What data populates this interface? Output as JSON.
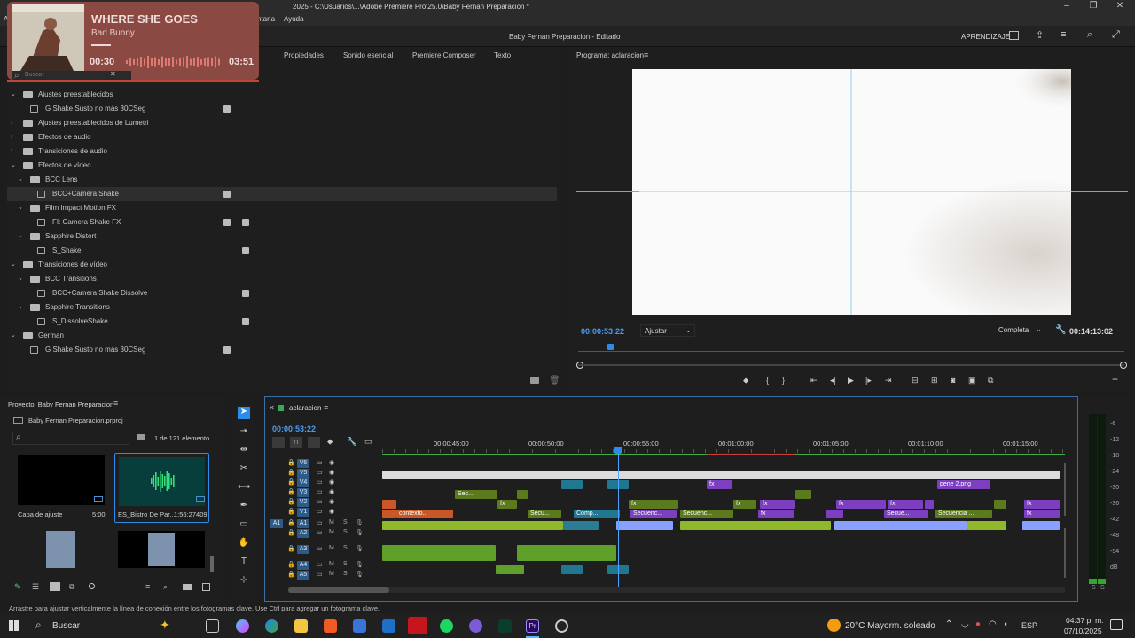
{
  "window": {
    "title": "2025 - C:\\Usuarios\\...\\Adobe Premiere Pro\\25.0\\Baby Fernan Preparacion *"
  },
  "menu": {
    "items": [
      "A",
      "ntana",
      "Ayuda"
    ]
  },
  "header": {
    "project_title": "Baby Fernan Preparacion - Editado",
    "workspace": "APRENDIZAJE"
  },
  "media_overlay": {
    "song": "WHERE SHE GOES",
    "artist": "Bad Bunny",
    "elapsed": "00:30",
    "duration": "03:51"
  },
  "effects_panel": {
    "tabs": [
      "Propiedades",
      "Sonido esencial",
      "Premiere Composer",
      "Texto"
    ],
    "search_placeholder": "Buscar",
    "tree": [
      {
        "label": "Ajustes preestablecidos",
        "level": 0,
        "type": "folder",
        "state": "open"
      },
      {
        "label": "G Shake Susto no más 30CSeg",
        "level": 1,
        "type": "preset",
        "badge": true
      },
      {
        "label": "Ajustes preestablecidos de Lumetri",
        "level": 0,
        "type": "folder",
        "state": "closed"
      },
      {
        "label": "Efectos de audio",
        "level": 0,
        "type": "folder",
        "state": "closed"
      },
      {
        "label": "Transiciones de audio",
        "level": 0,
        "type": "folder",
        "state": "closed"
      },
      {
        "label": "Efectos de vídeo",
        "level": 0,
        "type": "folder",
        "state": "open"
      },
      {
        "label": "BCC Lens",
        "level": 1,
        "type": "folder",
        "state": "open"
      },
      {
        "label": "BCC+Camera Shake",
        "level": 2,
        "type": "effect",
        "badge": true,
        "selected": true
      },
      {
        "label": "Film Impact Motion FX",
        "level": 1,
        "type": "folder",
        "state": "open"
      },
      {
        "label": "FI: Camera Shake FX",
        "level": 2,
        "type": "effect",
        "badge": true,
        "badge2": true
      },
      {
        "label": "Sapphire Distort",
        "level": 1,
        "type": "folder",
        "state": "open"
      },
      {
        "label": "S_Shake",
        "level": 2,
        "type": "effect",
        "badge2": true
      },
      {
        "label": "Transiciones de vídeo",
        "level": 0,
        "type": "folder",
        "state": "open"
      },
      {
        "label": "BCC Transitions",
        "level": 1,
        "type": "folder",
        "state": "open"
      },
      {
        "label": "BCC+Camera Shake Dissolve",
        "level": 2,
        "type": "transition",
        "badge2": true
      },
      {
        "label": "Sapphire Transitions",
        "level": 1,
        "type": "folder",
        "state": "open"
      },
      {
        "label": "S_DissolveShake",
        "level": 2,
        "type": "transition",
        "badge2": true
      },
      {
        "label": "German",
        "level": 0,
        "type": "folder",
        "state": "open"
      },
      {
        "label": "G Shake Susto no más 30CSeg",
        "level": 1,
        "type": "preset",
        "badge": true
      }
    ]
  },
  "program_monitor": {
    "label": "Programa: aclaracion",
    "timecode": "00:00:53:22",
    "fit": "Ajustar",
    "quality": "Completa",
    "duration": "00:14:13:02"
  },
  "project_panel": {
    "title": "Proyecto: Baby Fernan Preparacion",
    "file": "Baby Fernan Preparacion.prproj",
    "count": "1 de 121 elemento...",
    "items": [
      {
        "name": "Capa de ajuste",
        "duration": "5:00"
      },
      {
        "name": "ES_Bistro De Par...",
        "duration": "1:56:27409"
      }
    ]
  },
  "timeline": {
    "sequence": "aclaracion",
    "timecode": "00:00:53:22",
    "ruler": [
      "00:00:45:00",
      "00:00:50:00",
      "00:00:55:00",
      "00:01:00:00",
      "00:01:05:00",
      "00:01:10:00",
      "00:01:15:00"
    ],
    "video_tracks": [
      "V6",
      "V5",
      "V4",
      "V3",
      "V2",
      "V1"
    ],
    "audio_tracks": [
      "A1",
      "A2",
      "A3",
      "A4",
      "A5"
    ],
    "clip_labels": [
      "contexto...",
      "Sec...",
      "Secu...",
      "Comp...",
      "Secuenc...",
      "Secuenc...",
      "Secuenc...",
      "Secue...",
      "Secue...",
      "Secuencia ...",
      "pene 2.png",
      "fx"
    ]
  },
  "meters": {
    "scale": [
      "-6",
      "-12",
      "-18",
      "-24",
      "-30",
      "-36",
      "-42",
      "-48",
      "-54",
      "dB"
    ]
  },
  "status_bar": {
    "text": "Arrastre para ajustar verticalmente la línea de conexión entre los fotogramas clave. Use Ctrl para agregar un fotograma clave."
  },
  "taskbar": {
    "search": "Buscar",
    "weather": "20°C  Mayorm. soleado",
    "lang": "ESP",
    "time": "04:37 p. m.",
    "date": "07/10/2025"
  },
  "colors": {
    "accent": "#2d8ceb",
    "video_clip": "#7b3fbf",
    "audio_clip": "#8fb82a",
    "orange_clip": "#c8582a",
    "teal_clip": "#1f7890"
  }
}
